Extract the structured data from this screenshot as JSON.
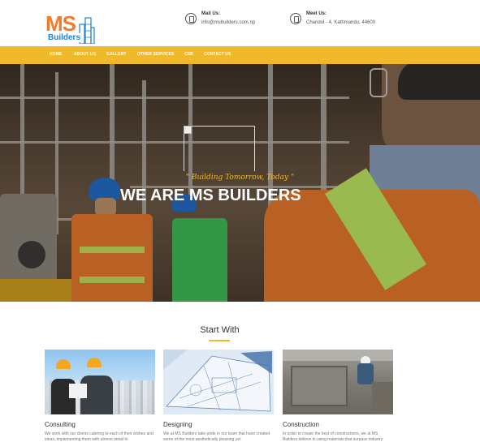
{
  "logo": {
    "main": "MS",
    "sub": "Builders"
  },
  "contact": {
    "mail": {
      "title": "Mail Us:",
      "value": "info@msbuilders.com.np",
      "icon": "mail-icon"
    },
    "meet": {
      "title": "Meet Us:",
      "value": "Chandol - 4, Kathmandu, 44600",
      "icon": "location-icon"
    }
  },
  "nav": {
    "items": [
      "HOME",
      "ABOUT US",
      "GALLERY",
      "OTHER SERVICES",
      "CSR",
      "CONTACT US"
    ]
  },
  "hero": {
    "tagline": "\" Building Tomorrow, Today \"",
    "title": "WE ARE MS BUILDERS"
  },
  "section": {
    "title": "Start With",
    "cards": [
      {
        "title": "Consulting",
        "desc": "We work with our clients catering to each of their wishes and ideas, implementing them with utmost detail to"
      },
      {
        "title": "Designing",
        "desc": "We at MS Builders take pride in our team that have created some of the most aesthetically pleasing yet"
      },
      {
        "title": "Construction",
        "desc": "In order to create the best of constructions, we at MS Builders believe in using materials that surpass industry"
      }
    ]
  },
  "colors": {
    "accent": "#f0b92b",
    "logo_orange": "#f07b2d",
    "logo_blue": "#1f7fd8"
  }
}
